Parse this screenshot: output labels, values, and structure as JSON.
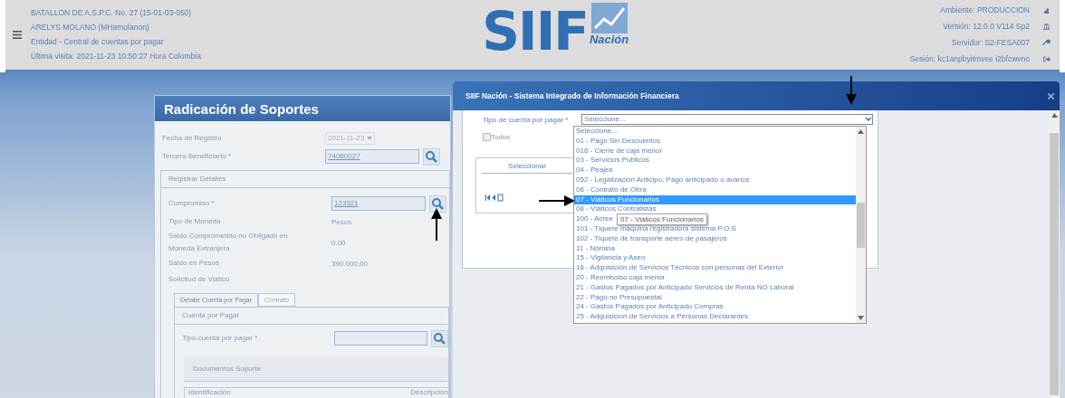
{
  "header": {
    "left_lines": [
      "BATALLON DE A.S.P.C. No. 27 (15-01-03-050)",
      "ARELYS MOLANO (MHamolanon)",
      "Entidad - Central de cuentas por pagar",
      "Última visita: 2021-11-23 10:50:27 Hora Colombia"
    ],
    "logo": {
      "primary": "SIIF",
      "secondary": "Nación"
    },
    "right_lines": [
      "Ambiente: PRODUCCION",
      "Versión: 12.0.0 V114 Sp2",
      "Servidor: S2-FESA007",
      "Sesión: kc1anpbyitmvee i2bfcwvno"
    ]
  },
  "form": {
    "title": "Radicación de Soportes",
    "top_rows": [
      {
        "kind": "select",
        "label": "Fecha de Registro",
        "value": "2021-11-23"
      },
      {
        "kind": "search",
        "label": "Tercero Beneficiario *",
        "value": "74080027"
      }
    ],
    "section": "Registrar Detalles",
    "detail_rows": [
      {
        "kind": "search",
        "label": "Compromiso *",
        "value": "123321"
      },
      {
        "kind": "text",
        "label": "Tipo de Moneda",
        "value": "Pesos"
      },
      {
        "kind": "text",
        "label": "Saldo Comprometido no Obligado en Moneda Extranjera",
        "value": "0.00"
      },
      {
        "kind": "text",
        "label": "Saldo en Pesos",
        "value": "390.000,00"
      },
      {
        "kind": "text",
        "label": "Solicitud de Viático"
      }
    ],
    "tabs": [
      {
        "label": "Detalle Cuenta por Pagar",
        "selected": true
      },
      {
        "label": "Contrato",
        "selected": false
      }
    ],
    "subsection": "Cuenta por Pagar",
    "tipo_cuenta": {
      "label": "Tipo cuenta por pagar *"
    },
    "documentos": "Documentos Soporte",
    "columns": [
      "Identificación",
      "Descripción"
    ]
  },
  "dialog": {
    "title": "SIIF Nación - Sistema Integrado de Información Financiera",
    "field_label": "Tipo de cuenta por pagar *",
    "select_value": "Seleccione...",
    "todos": {
      "label": "Todos",
      "checked": false
    },
    "column": "Seleccionar",
    "options": [
      {
        "label": "Seleccione...",
        "selected": false
      },
      {
        "label": "01 - Pago Sin Descuentos",
        "selected": false
      },
      {
        "label": "016 - Cierre de caja menor",
        "selected": false
      },
      {
        "label": "03 - Servicios Publicos",
        "selected": false
      },
      {
        "label": "04 - Peajes",
        "selected": false
      },
      {
        "label": "052 - Legalización Anticipo, Pago anticipado o avance",
        "selected": false
      },
      {
        "label": "06 - Contrato de Obra",
        "selected": false
      },
      {
        "label": "07 - Viáticos Funcionarios",
        "selected": true
      },
      {
        "label": "08 - Viáticos Contratistas",
        "selected": false
      },
      {
        "label": "100 - Acree",
        "selected": false
      },
      {
        "label": "101 - Tiquete máquina registradora sistema P.O.S",
        "selected": false
      },
      {
        "label": "102 - Tiquete de transporte aéreo de pasajeros",
        "selected": false
      },
      {
        "label": "11 - Nómina",
        "selected": false
      },
      {
        "label": "15 - Vigilancia y Aseo",
        "selected": false
      },
      {
        "label": "16 - Adquisición de Servicios Técnicos con personas del Exterior",
        "selected": false
      },
      {
        "label": "20 - Reembolso caja menor",
        "selected": false
      },
      {
        "label": "21 - Gastos Pagados por Anticipado Servicios de Renta NO Laboral",
        "selected": false
      },
      {
        "label": "22 - Pago no Presupuestal",
        "selected": false
      },
      {
        "label": "24 - Gastos Pagados por Anticipado Compras",
        "selected": false
      },
      {
        "label": "25 - Adquisicion de Servicios a Personas Declarantes",
        "selected": false
      }
    ],
    "tooltip": "07 - Viáticos Funcionarios"
  }
}
